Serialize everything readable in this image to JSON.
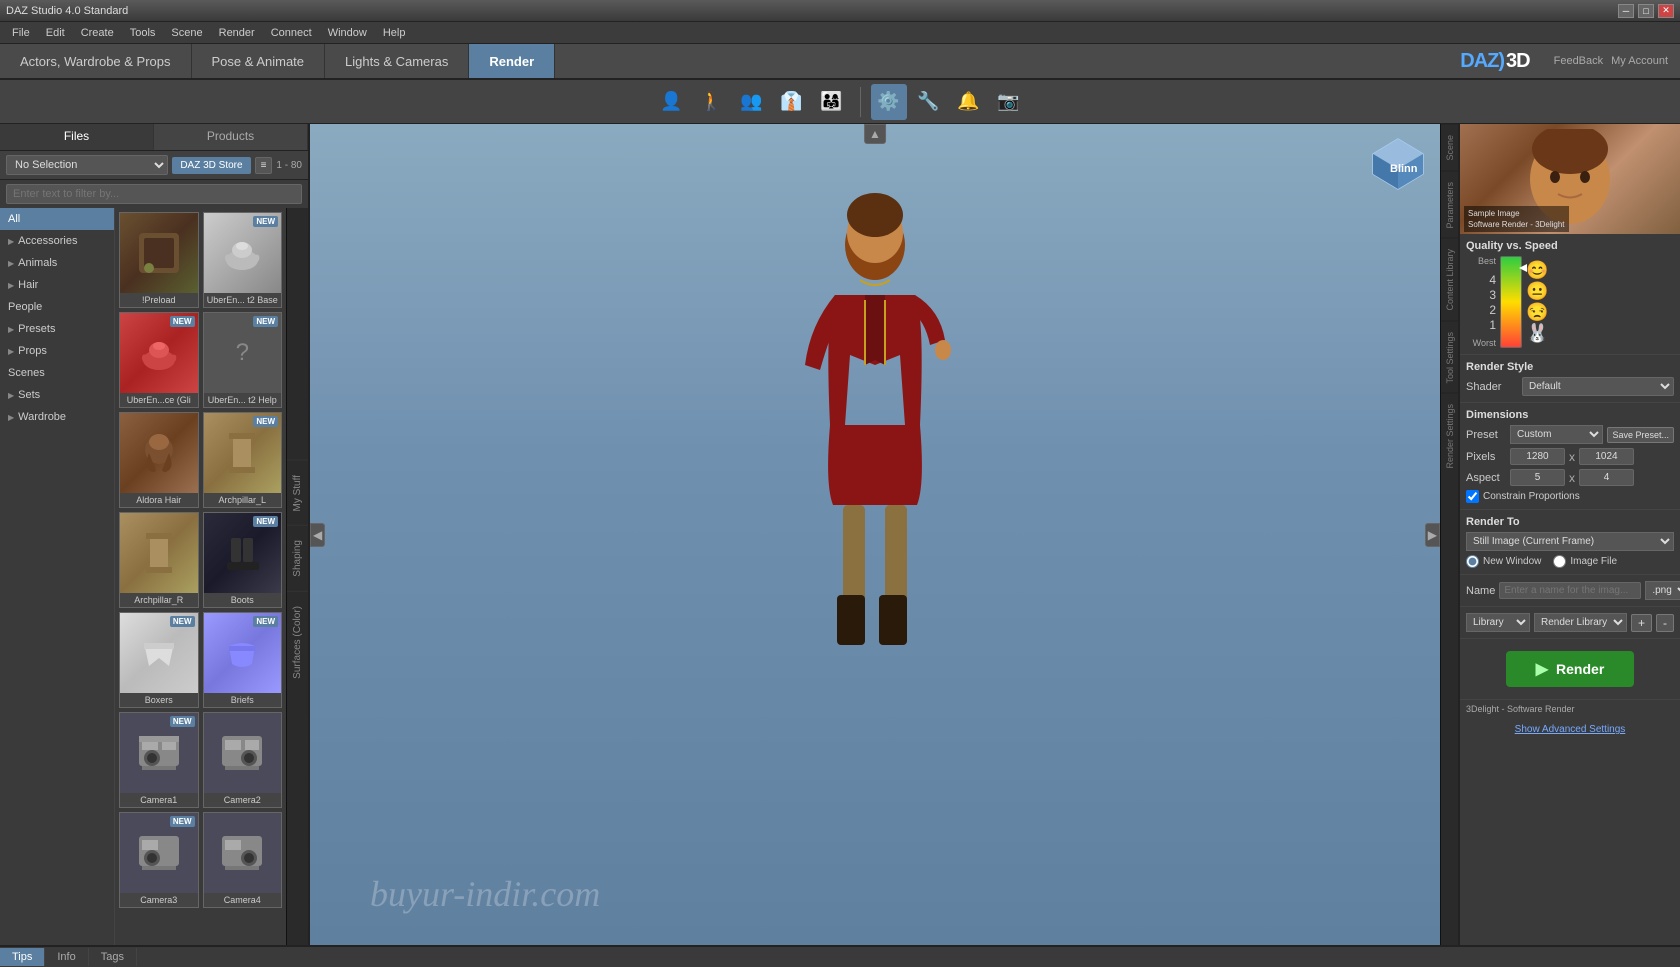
{
  "titlebar": {
    "title": "DAZ Studio 4.0 Standard",
    "controls": [
      "minimize",
      "maximize",
      "close"
    ]
  },
  "menubar": {
    "items": [
      "File",
      "Edit",
      "Create",
      "Tools",
      "Scene",
      "Render",
      "Connect",
      "Window",
      "Help"
    ]
  },
  "navtabs": {
    "tabs": [
      "Actors, Wardrobe & Props",
      "Pose & Animate",
      "Lights & Cameras",
      "Render"
    ],
    "active": "Render",
    "logo": "DAZ) 3D",
    "right_buttons": [
      "FeedBack",
      "My Account"
    ]
  },
  "toolbar": {
    "icons": [
      "👤",
      "👣",
      "👥",
      "👔",
      "👨‍👩‍👧"
    ],
    "right_icons": [
      "⚙️",
      "🔧",
      "🔔",
      "📷"
    ]
  },
  "left_panel": {
    "tabs": [
      "Files",
      "Products"
    ],
    "store_btn": "DAZ 3D Store",
    "selector": "No Selection",
    "count": "1 - 80",
    "search_placeholder": "Enter text to filter by...",
    "categories": [
      {
        "label": "All",
        "active": true,
        "arrow": false
      },
      {
        "label": "Accessories",
        "active": false,
        "arrow": true
      },
      {
        "label": "Animals",
        "active": false,
        "arrow": true
      },
      {
        "label": "Hair",
        "active": false,
        "arrow": true
      },
      {
        "label": "People",
        "active": false,
        "arrow": false
      },
      {
        "label": "Presets",
        "active": false,
        "arrow": true
      },
      {
        "label": "Props",
        "active": false,
        "arrow": true
      },
      {
        "label": "Scenes",
        "active": false,
        "arrow": false
      },
      {
        "label": "Sets",
        "active": false,
        "arrow": true
      },
      {
        "label": "Wardrobe",
        "active": false,
        "arrow": true
      }
    ],
    "files": [
      {
        "label": "!Preload",
        "badge": "",
        "thumb": "preload"
      },
      {
        "label": "UberEn... t2 Base",
        "badge": "NEW",
        "thumb": "teapot"
      },
      {
        "label": "UberEn...ce (Gli",
        "badge": "NEW",
        "thumb": "teapot-red"
      },
      {
        "label": "UberEn... t2 Help",
        "badge": "NEW",
        "thumb": "teapot"
      },
      {
        "label": "Aldora Hair",
        "badge": "",
        "thumb": "hair"
      },
      {
        "label": "Archpillar_L",
        "badge": "NEW",
        "thumb": "arch"
      },
      {
        "label": "Archpillar_R",
        "badge": "",
        "thumb": "arch"
      },
      {
        "label": "Boots",
        "badge": "NEW",
        "thumb": "boots"
      },
      {
        "label": "Boxers",
        "badge": "NEW",
        "thumb": "boxers"
      },
      {
        "label": "Briefs",
        "badge": "NEW",
        "thumb": "briefs"
      },
      {
        "label": "Camera1",
        "badge": "NEW",
        "thumb": "cam"
      },
      {
        "label": "Camera2",
        "badge": "",
        "thumb": "cam"
      },
      {
        "label": "Camera3",
        "badge": "NEW",
        "thumb": "cam"
      },
      {
        "label": "Camera4",
        "badge": "",
        "thumb": "cam"
      }
    ]
  },
  "vertical_tabs": {
    "items": [
      "My Stuff",
      "Shaping",
      "Surfaces (Color)"
    ]
  },
  "viewport": {
    "watermark": "buyur-indir.com"
  },
  "right_panel": {
    "sub_tabs": [
      "Scene",
      "Parameters",
      "Content Library",
      "Tool Settings",
      "Render Settings"
    ],
    "quality_title": "Quality vs. Speed",
    "quality_labels": [
      "Best",
      "Worst"
    ],
    "quality_values": [
      "4",
      "3",
      "2",
      "1"
    ],
    "sample_title": "Sample Image",
    "sample_subtitle": "Software Render - 3Delight",
    "render_style_label": "Render Style",
    "shader_label": "Shader",
    "shader_value": "Default",
    "dimensions_label": "Dimensions",
    "preset_label": "Preset",
    "preset_value": "Custom",
    "save_preset_btn": "Save Preset...",
    "pixels_label": "Pixels",
    "pixels_w": "1280",
    "pixels_x": "x",
    "pixels_h": "1024",
    "aspect_label": "Aspect",
    "aspect_w": "5",
    "aspect_h": "4",
    "constrain_label": "Constrain Proportions",
    "constrain_checked": true,
    "render_to_label": "Render To",
    "render_to_value": "Still Image (Current Frame)",
    "new_window_label": "New Window",
    "image_file_label": "Image File",
    "name_label": "Name",
    "name_placeholder": "Enter a name for the imag...",
    "name_format": ".png",
    "library_label": "Library",
    "library_value": "Render Library",
    "library_add": "+",
    "library_remove": "-",
    "render_btn": "Render",
    "render_icon": "▶",
    "footer_text": "3Delight - Software Render",
    "show_advanced": "Show Advanced Settings"
  },
  "bottom_tabs": {
    "items": [
      "Tips",
      "Info",
      "Tags"
    ],
    "active": "Tips"
  }
}
